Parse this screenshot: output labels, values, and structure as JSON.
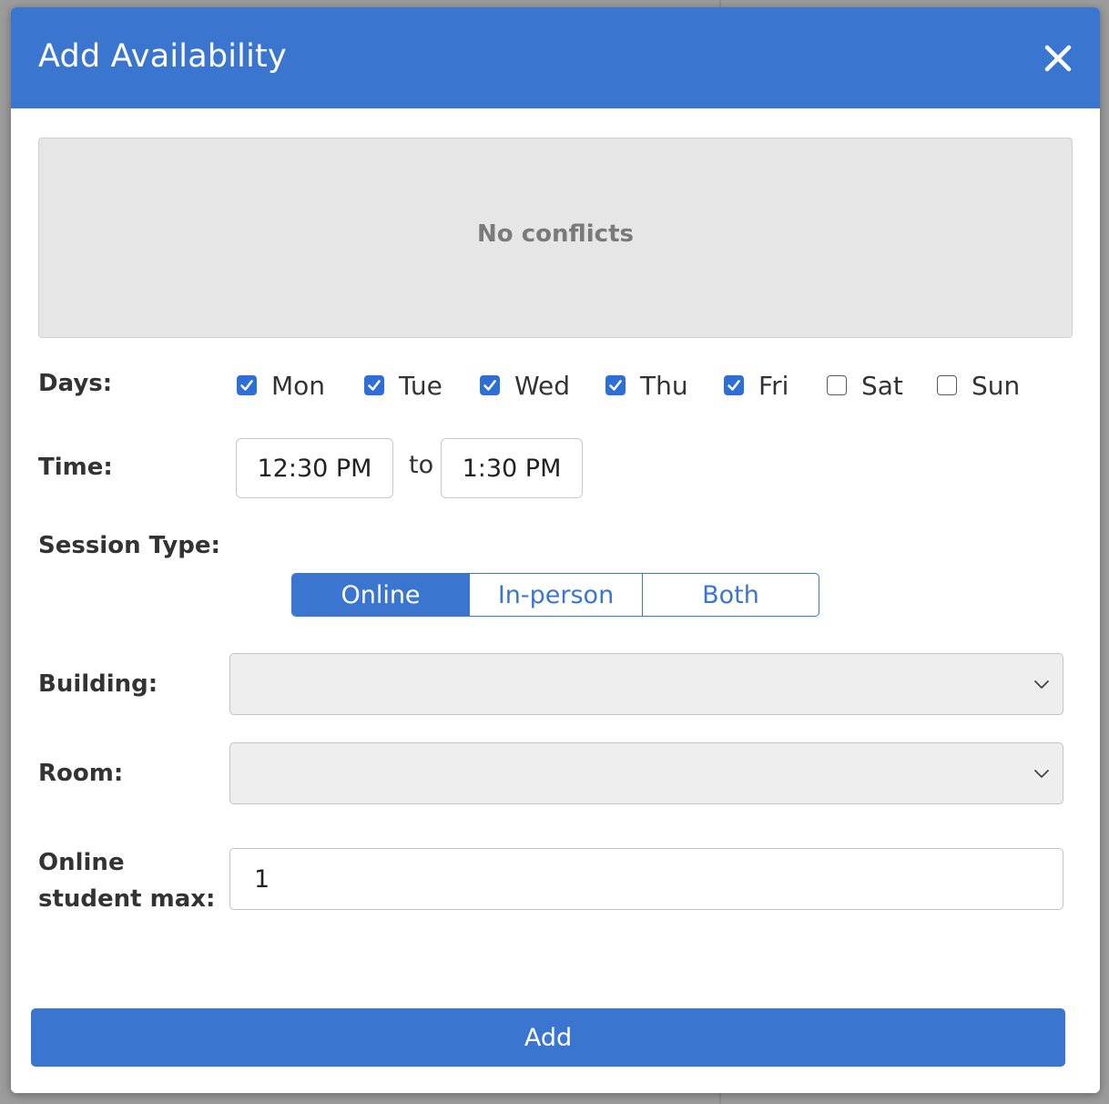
{
  "modal": {
    "title": "Add Availability",
    "close_icon": "close-icon"
  },
  "conflicts": {
    "message": "No conflicts"
  },
  "days": {
    "label": "Days:",
    "items": [
      {
        "label": "Mon",
        "checked": true
      },
      {
        "label": "Tue",
        "checked": true
      },
      {
        "label": "Wed",
        "checked": true
      },
      {
        "label": "Thu",
        "checked": true
      },
      {
        "label": "Fri",
        "checked": true
      },
      {
        "label": "Sat",
        "checked": false
      },
      {
        "label": "Sun",
        "checked": false
      }
    ]
  },
  "time": {
    "label": "Time:",
    "start": "12:30 PM",
    "separator": "to",
    "end": "1:30 PM"
  },
  "session_type": {
    "label": "Session Type:",
    "options": [
      "Online",
      "In-person",
      "Both"
    ],
    "selected": "Online"
  },
  "building": {
    "label": "Building:",
    "value": ""
  },
  "room": {
    "label": "Room:",
    "value": ""
  },
  "online_max": {
    "label_line1": "Online",
    "label_line2": "student max:",
    "value": "1"
  },
  "actions": {
    "add_label": "Add"
  },
  "colors": {
    "accent": "#3a76cf",
    "checkbox": "#2d6fd6",
    "conflict_bg": "#e6e6e6"
  }
}
